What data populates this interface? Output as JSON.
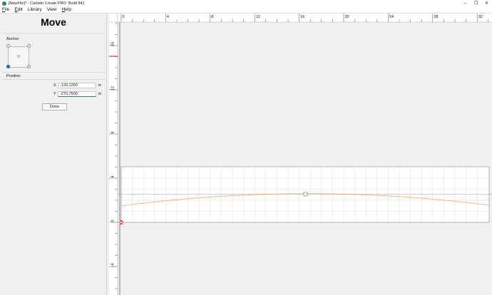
{
  "window": {
    "title": "[NewFile]* - Carbide Create PRO: Build 841",
    "buttons": {
      "minimize": "–",
      "maximize": "❐",
      "close": "✕"
    }
  },
  "menu": [
    {
      "label": "File",
      "u": "F",
      "rest": "ile"
    },
    {
      "label": "Edit",
      "u": "E",
      "rest": "dit"
    },
    {
      "label": "Library",
      "u": "",
      "rest": "Library"
    },
    {
      "label": "View",
      "u": "",
      "rest": "View"
    },
    {
      "label": "Help",
      "u": "H",
      "rest": "elp"
    }
  ],
  "panel": {
    "title": "Move",
    "anchor_label": "Anchor",
    "selected_anchor": "bottom-left",
    "position_label": "Position",
    "x_label": "X",
    "x_value": "-120.1250",
    "y_label": "Y",
    "y_value": "-270.7500",
    "unit": "in",
    "done_label": "Done"
  },
  "ruler": {
    "x_ticks": [
      "0",
      "4",
      "8",
      "12",
      "16",
      "20",
      "24",
      "28",
      "32"
    ],
    "y_ticks": [
      "16",
      "12",
      "8",
      "4",
      "0",
      "-4"
    ]
  },
  "colors": {
    "curve": "#f08a3c",
    "marker": "#e0301e",
    "grid": "#dcdcdc",
    "focus": "#2b6cd6"
  }
}
